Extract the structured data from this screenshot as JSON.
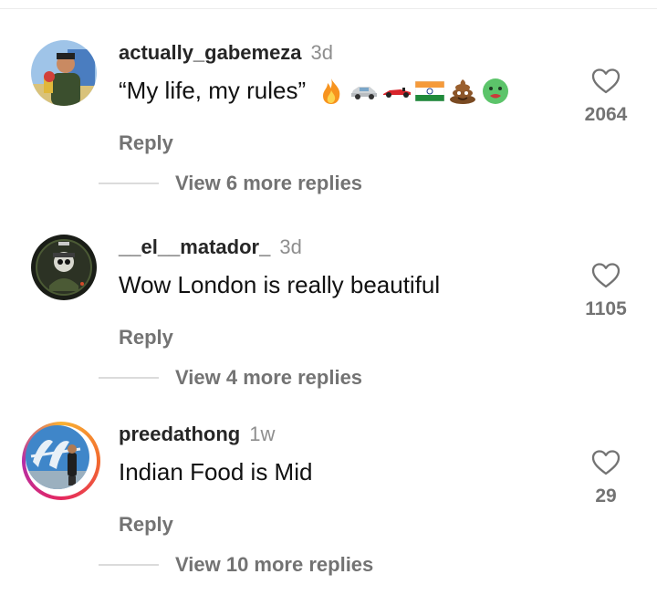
{
  "comments": [
    {
      "username": "actually_gabemeza",
      "age": "3d",
      "text": "“My life, my rules”",
      "emojis": [
        "fire-emoji",
        "car-emoji",
        "race-car-emoji",
        "india-flag-emoji",
        "poop-emoji",
        "nauseated-face-emoji"
      ],
      "reply_label": "Reply",
      "likes": "2064",
      "view_replies": "View 6 more replies"
    },
    {
      "username": "__el__matador_",
      "age": "3d",
      "text": "Wow London is really beautiful",
      "reply_label": "Reply",
      "likes": "1105",
      "view_replies": "View 4 more replies"
    },
    {
      "username": "preedathong",
      "age": "1w",
      "text": "Indian Food is Mid",
      "reply_label": "Reply",
      "likes": "29",
      "view_replies": "View 10 more replies"
    }
  ],
  "colors": {
    "text_primary": "#262626",
    "text_secondary": "#737373",
    "story_ring": [
      "#f9b233",
      "#e5275f",
      "#b42ea8"
    ]
  }
}
